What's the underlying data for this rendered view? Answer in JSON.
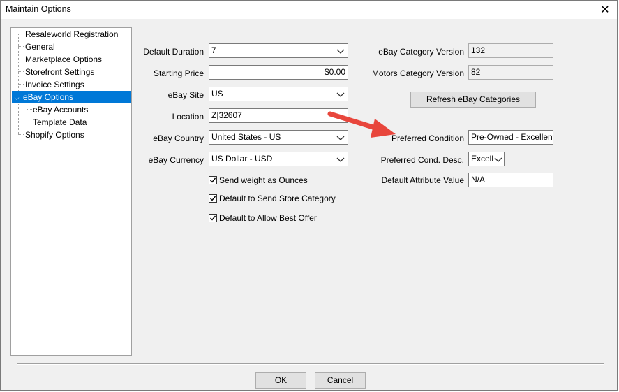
{
  "window": {
    "title": "Maintain Options",
    "close_icon": "close-icon"
  },
  "tree": {
    "items": [
      {
        "label": "Resaleworld Registration"
      },
      {
        "label": "General"
      },
      {
        "label": "Marketplace Options"
      },
      {
        "label": "Storefront Settings"
      },
      {
        "label": "Invoice Settings"
      },
      {
        "label": "eBay Options",
        "selected": true,
        "expanded": true
      },
      {
        "label": "eBay Accounts"
      },
      {
        "label": "Template Data"
      },
      {
        "label": "Shopify Options"
      }
    ]
  },
  "form": {
    "default_duration": {
      "label": "Default Duration",
      "value": "7"
    },
    "starting_price": {
      "label": "Starting Price",
      "value": "$0.00"
    },
    "ebay_site": {
      "label": "eBay Site",
      "value": "US"
    },
    "location": {
      "label": "Location",
      "value": "Z|32607"
    },
    "ebay_country": {
      "label": "eBay Country",
      "value": "United States - US"
    },
    "ebay_currency": {
      "label": "eBay Currency",
      "value": "US Dollar - USD"
    },
    "send_weight": {
      "label": "Send weight as Ounces",
      "checked": true
    },
    "send_store_category": {
      "label": "Default to Send Store Category",
      "checked": true
    },
    "allow_best_offer": {
      "label": "Default to Allow Best Offer",
      "checked": true
    }
  },
  "right": {
    "category_version": {
      "label": "eBay Category Version",
      "value": "132"
    },
    "motors_version": {
      "label": "Motors Category Version",
      "value": "82"
    },
    "refresh_button": "Refresh eBay Categories",
    "preferred_condition": {
      "label": "Preferred Condition",
      "value": "Pre-Owned - Excellent|N"
    },
    "preferred_cond_desc": {
      "label": "Preferred Cond. Desc.",
      "value": "Excelle"
    },
    "default_attribute": {
      "label": "Default Attribute Value",
      "value": "N/A"
    }
  },
  "buttons": {
    "ok": "OK",
    "cancel": "Cancel"
  },
  "colors": {
    "selection": "#0078d7",
    "annotation_arrow": "#e8463c"
  }
}
